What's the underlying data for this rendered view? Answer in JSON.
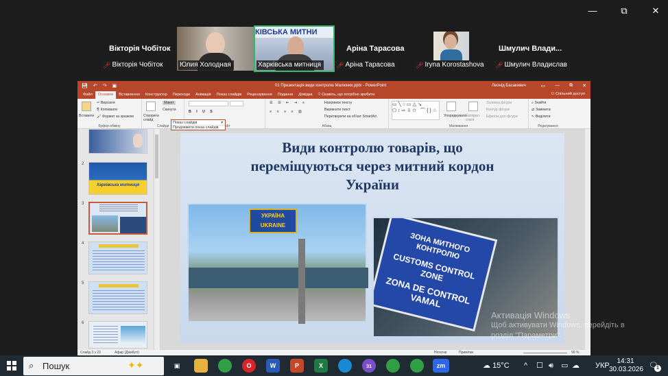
{
  "window": {
    "minimize": "—",
    "restore": "⧉",
    "close": "✕"
  },
  "participants": {
    "name_1": "Вікторія Чобіток",
    "name_2": "Аріна Тарасова",
    "name_3": "Шмулич  Влади...",
    "tag_1": "Вікторія Чобіток",
    "tag_2": "Юлия Холодная",
    "tag_3": "Харківська митниця",
    "tag_4": "Аріна Тарасова",
    "tag_5": "Iryna Korostashova",
    "tag_6": "Шмулич Владислав",
    "banner": "КІВСЬКА МИТНИ"
  },
  "ppt": {
    "doc_title": "01 Презентація види контролю Малюнки.pptx  -  PowerPoint",
    "user": "Леонід Басакевич",
    "tabs": [
      "Файл",
      "Основне",
      "Вставлення",
      "Конструктор",
      "Переходи",
      "Анімація",
      "Показ слайдів",
      "Рецензування",
      "Подання",
      "Довідка",
      "Скажіть, що потрібно зробити"
    ],
    "share": "Спільний доступ",
    "ribbon": {
      "paste": "Вставити",
      "cut": "Вирізати",
      "copy": "Копіювати",
      "format_painter": "Формат за зразком",
      "clipboard": "Буфер обміну",
      "new_slide": "Створити слайд",
      "layout": "Макет",
      "reset": "Скинути",
      "slides": "Слайди",
      "font": "Шрифт",
      "text_direction": "Напрямок тексту",
      "align_text": "Вирівняти текст",
      "smartart": "Перетворити на об'єкт SmartArt",
      "paragraph": "Абзац",
      "arrange": "Упорядкувати",
      "quick_styles": "Експрес-стилі",
      "fill": "Заливка фігури",
      "outline": "Контур фігури",
      "effects": "Ефекти для фігури",
      "drawing": "Малювання",
      "find": "Знайти",
      "replace": "Замінити",
      "select": "Виділити",
      "editing": "Редагування"
    },
    "dropdown": {
      "selected": "Показ слайдів",
      "option": "Продовжити показ слайдів"
    },
    "thumb_numbers": [
      "2",
      "3",
      "4",
      "5",
      "6"
    ],
    "thumb2_text": "Харківська митниця",
    "slide": {
      "title_line1": "Види контролю товарів, що",
      "title_line2": "переміщуються через митний кордон",
      "title_line3": "України",
      "sign1_line1": "УКРАЇНА",
      "sign1_line2": "UKRAINE",
      "sign2_line1": "ЗОНА МИТНОГО КОНТРОЛЮ",
      "sign2_line2": "CUSTOMS CONTROL ZONE",
      "sign2_line3": "ZONA DE CONTROL VAMAL"
    },
    "status": {
      "slide_of": "Слайд 3 з 23",
      "lang": "Афар (Джибуті)",
      "notes": "Нотатки",
      "comments": "Примітки",
      "zoom": "90 %"
    }
  },
  "watermark": {
    "line1": "Активація Windows",
    "line2": "Щоб активувати Windows, перейдіть в",
    "line3": "розділ \"Параметри\"."
  },
  "taskbar": {
    "search": "Пошук",
    "weather": "15°C",
    "lang": "УКР",
    "time": "14:31",
    "date": "30.03.2026",
    "notif_count": "1",
    "badge_count": "31"
  }
}
